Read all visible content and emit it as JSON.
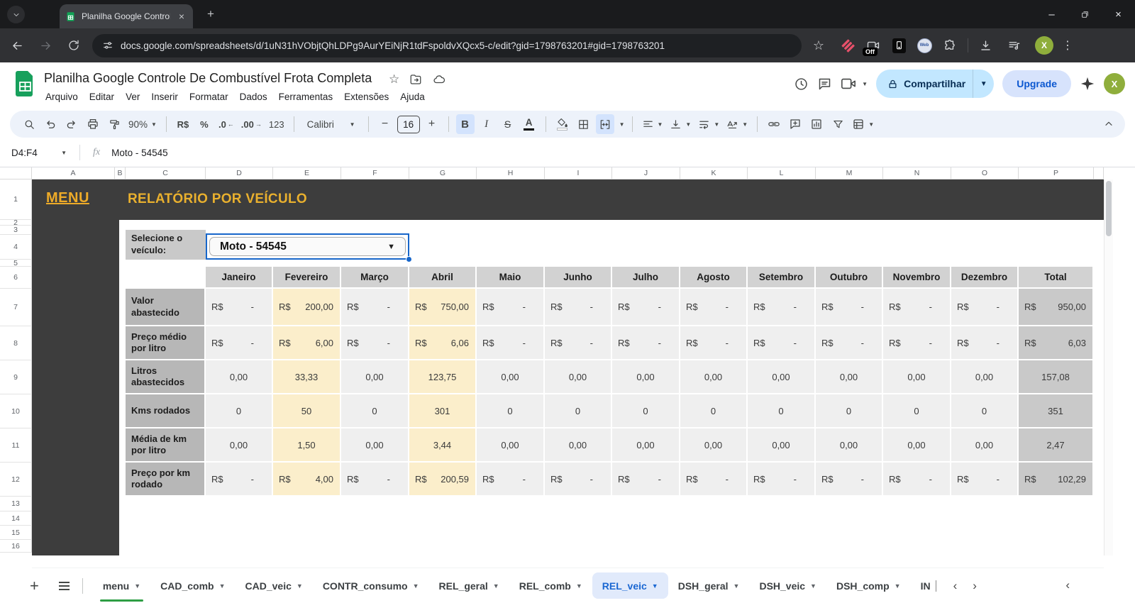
{
  "browser": {
    "tab_title": "Planilha Google Controle De Co",
    "url": "docs.google.com/spreadsheets/d/1uN31hVObjtQhLDPg9AurYEiNjR1tdFspoldvXQcx5-c/edit?gid=1798763201#gid=1798763201",
    "ext_off_label": "Off",
    "ext_web_label": "Web"
  },
  "header": {
    "doc_title": "Planilha Google Controle De Combustível Frota Completa",
    "menus": [
      "Arquivo",
      "Editar",
      "Ver",
      "Inserir",
      "Formatar",
      "Dados",
      "Ferramentas",
      "Extensões",
      "Ajuda"
    ],
    "share_label": "Compartilhar",
    "upgrade_label": "Upgrade"
  },
  "toolbar": {
    "zoom_level": "90%",
    "currency_label": "R$",
    "percent_label": "%",
    "decrease_decimal_label": ".0",
    "increase_decimal_label": ".00",
    "more_formats_label": "123",
    "font_name": "Calibri",
    "font_size": "16",
    "bold_label": "B",
    "italic_label": "I",
    "strikethrough_label": "S",
    "text_color_label": "A"
  },
  "formula_bar": {
    "name_box": "D4:F4",
    "fx_label": "fx",
    "value": "Moto - 54545"
  },
  "grid": {
    "col_letters": [
      "A",
      "B",
      "C",
      "D",
      "E",
      "F",
      "G",
      "H",
      "I",
      "J",
      "K",
      "L",
      "M",
      "N",
      "O",
      "P"
    ],
    "row_numbers": [
      "1",
      "2",
      "3",
      "4",
      "5",
      "6",
      "7",
      "8",
      "9",
      "10",
      "11",
      "12",
      "13",
      "14",
      "15",
      "16"
    ]
  },
  "sheet": {
    "menu_link": "MENU",
    "page_title": "RELATÓRIO POR VEÍCULO",
    "select_label": "Selecione o veículo:",
    "vehicle": "Moto - 54545"
  },
  "report_table": {
    "currency_symbol": "R$",
    "months": [
      "Janeiro",
      "Fevereiro",
      "Março",
      "Abril",
      "Maio",
      "Junho",
      "Julho",
      "Agosto",
      "Setembro",
      "Outubro",
      "Novembro",
      "Dezembro"
    ],
    "total_label": "Total",
    "rows": [
      {
        "label": "Valor abastecido",
        "format": "currency",
        "values": [
          "-",
          "200,00",
          "-",
          "750,00",
          "-",
          "-",
          "-",
          "-",
          "-",
          "-",
          "-",
          "-"
        ],
        "total": "950,00"
      },
      {
        "label": "Preço médio por litro",
        "format": "currency",
        "values": [
          "-",
          "6,00",
          "-",
          "6,06",
          "-",
          "-",
          "-",
          "-",
          "-",
          "-",
          "-",
          "-"
        ],
        "total": "6,03"
      },
      {
        "label": "Litros abastecidos",
        "format": "number",
        "values": [
          "0,00",
          "33,33",
          "0,00",
          "123,75",
          "0,00",
          "0,00",
          "0,00",
          "0,00",
          "0,00",
          "0,00",
          "0,00",
          "0,00"
        ],
        "total": "157,08"
      },
      {
        "label": "Kms rodados",
        "format": "number",
        "values": [
          "0",
          "50",
          "0",
          "301",
          "0",
          "0",
          "0",
          "0",
          "0",
          "0",
          "0",
          "0"
        ],
        "total": "351"
      },
      {
        "label": "Média de km por litro",
        "format": "number",
        "values": [
          "0,00",
          "1,50",
          "0,00",
          "3,44",
          "0,00",
          "0,00",
          "0,00",
          "0,00",
          "0,00",
          "0,00",
          "0,00",
          "0,00"
        ],
        "total": "2,47"
      },
      {
        "label": "Preço por km rodado",
        "format": "currency",
        "values": [
          "-",
          "4,00",
          "-",
          "200,59",
          "-",
          "-",
          "-",
          "-",
          "-",
          "-",
          "-",
          "-"
        ],
        "total": "102,29"
      }
    ]
  },
  "sheet_tabs": {
    "tabs": [
      "menu",
      "CAD_comb",
      "CAD_veic",
      "CONTR_consumo",
      "REL_geral",
      "REL_comb",
      "REL_veic",
      "DSH_geral",
      "DSH_veic",
      "DSH_comp",
      "IN"
    ],
    "active_tab": "REL_veic",
    "colored_tab": "menu",
    "tab_color": "#2e9e44"
  }
}
